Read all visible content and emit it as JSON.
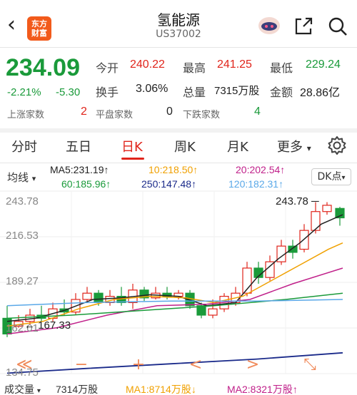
{
  "header": {
    "title": "氢能源",
    "code": "US37002",
    "logo_text": "东方财富"
  },
  "quote": {
    "price": "234.09",
    "change_pct": "-2.21%",
    "change_abs": "-5.30",
    "labels": {
      "open": "今开",
      "high": "最高",
      "low": "最低",
      "turnover": "换手",
      "volume": "总量",
      "amount": "金额"
    },
    "open": "240.22",
    "high": "241.25",
    "low": "229.24",
    "turnover": "3.06%",
    "volume": "7315万股",
    "amount": "28.86亿"
  },
  "breadth": {
    "up_label": "上涨家数",
    "up": "2",
    "flat_label": "平盘家数",
    "flat": "0",
    "down_label": "下跌家数",
    "down": "4"
  },
  "tabs": [
    "分时",
    "五日",
    "日K",
    "周K",
    "月K",
    "更多"
  ],
  "active_tab": "日K",
  "ma": {
    "selector": "均线",
    "ma5": "MA5:231.19↑",
    "ma10": "10:218.50↑",
    "ma20": "20:202.54↑",
    "ma60": "60:185.96↑",
    "ma250": "250:147.48↑",
    "ma120": "120:182.31↑",
    "dk_button": "DK点"
  },
  "chart_data": {
    "type": "candlestick",
    "y_ticks": [
      "243.78",
      "216.53",
      "189.27",
      "162.01",
      "134.75"
    ],
    "high_marker": "243.78",
    "low_marker": "167.33",
    "colors": {
      "up": "#e0241b",
      "down": "#1a9a3a",
      "ma5": "#222222",
      "ma10": "#f0a000",
      "ma20": "#c0208a",
      "ma60": "#1a9a3a",
      "ma120": "#5aa8e8",
      "ma250": "#1a2a8a"
    }
  },
  "controls": [
    "≪",
    "−",
    "+",
    "<",
    ">",
    "⤡"
  ],
  "volume": {
    "label": "成交量",
    "total": "7314万股",
    "ma1": "MA1:8714万股↓",
    "ma2": "MA2:8321万股↑"
  }
}
